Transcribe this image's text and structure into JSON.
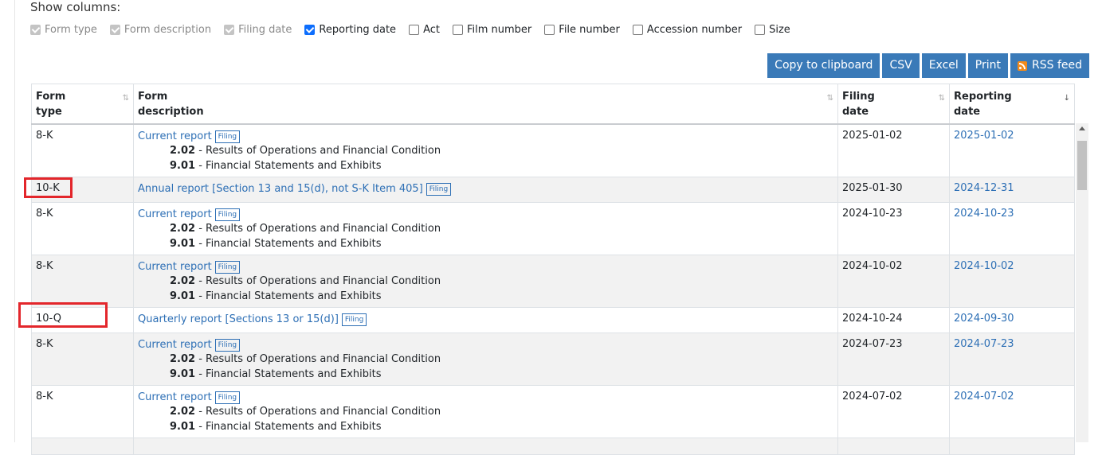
{
  "show_columns": {
    "title": "Show columns:",
    "toggles": [
      {
        "label": "Form type",
        "state": "disabled-checked"
      },
      {
        "label": "Form description",
        "state": "disabled-checked"
      },
      {
        "label": "Filing date",
        "state": "disabled-checked"
      },
      {
        "label": "Reporting date",
        "state": "checked"
      },
      {
        "label": "Act",
        "state": "unchecked"
      },
      {
        "label": "Film number",
        "state": "unchecked"
      },
      {
        "label": "File number",
        "state": "unchecked"
      },
      {
        "label": "Accession number",
        "state": "unchecked"
      },
      {
        "label": "Size",
        "state": "unchecked"
      }
    ]
  },
  "toolbar": {
    "copy": "Copy to clipboard",
    "csv": "CSV",
    "excel": "Excel",
    "print": "Print",
    "rss": "RSS feed"
  },
  "table": {
    "headers": {
      "form_type_1": "Form",
      "form_type_2": "type",
      "form_desc_1": "Form",
      "form_desc_2": "description",
      "filing_1": "Filing",
      "filing_2": "date",
      "reporting_1": "Reporting",
      "reporting_2": "date"
    },
    "sort_icon": "⇅",
    "badge": "Filing",
    "rows": [
      {
        "type": "8-K",
        "desc": "Current report",
        "items": [
          {
            "code": "2.02",
            "text": " - Results of Operations and Financial Condition"
          },
          {
            "code": "9.01",
            "text": " - Financial Statements and Exhibits"
          }
        ],
        "filing": "2025-01-02",
        "reporting": "2025-01-02"
      },
      {
        "type": "10-K",
        "desc": "Annual report [Section 13 and 15(d), not S-K Item 405]",
        "items": [],
        "filing": "2025-01-30",
        "reporting": "2024-12-31"
      },
      {
        "type": "8-K",
        "desc": "Current report",
        "items": [
          {
            "code": "2.02",
            "text": " - Results of Operations and Financial Condition"
          },
          {
            "code": "9.01",
            "text": " - Financial Statements and Exhibits"
          }
        ],
        "filing": "2024-10-23",
        "reporting": "2024-10-23"
      },
      {
        "type": "8-K",
        "desc": "Current report",
        "items": [
          {
            "code": "2.02",
            "text": " - Results of Operations and Financial Condition"
          },
          {
            "code": "9.01",
            "text": " - Financial Statements and Exhibits"
          }
        ],
        "filing": "2024-10-02",
        "reporting": "2024-10-02"
      },
      {
        "type": "10-Q",
        "desc": "Quarterly report [Sections 13 or 15(d)]",
        "items": [],
        "filing": "2024-10-24",
        "reporting": "2024-09-30"
      },
      {
        "type": "8-K",
        "desc": "Current report",
        "items": [
          {
            "code": "2.02",
            "text": " - Results of Operations and Financial Condition"
          },
          {
            "code": "9.01",
            "text": " - Financial Statements and Exhibits"
          }
        ],
        "filing": "2024-07-23",
        "reporting": "2024-07-23"
      },
      {
        "type": "8-K",
        "desc": "Current report",
        "items": [
          {
            "code": "2.02",
            "text": " - Results of Operations and Financial Condition"
          },
          {
            "code": "9.01",
            "text": " - Financial Statements and Exhibits"
          }
        ],
        "filing": "2024-07-02",
        "reporting": "2024-07-02"
      }
    ]
  },
  "colors": {
    "accent": "#3a7ab8",
    "link": "#2d6fb5",
    "highlight": "#e3262b"
  }
}
